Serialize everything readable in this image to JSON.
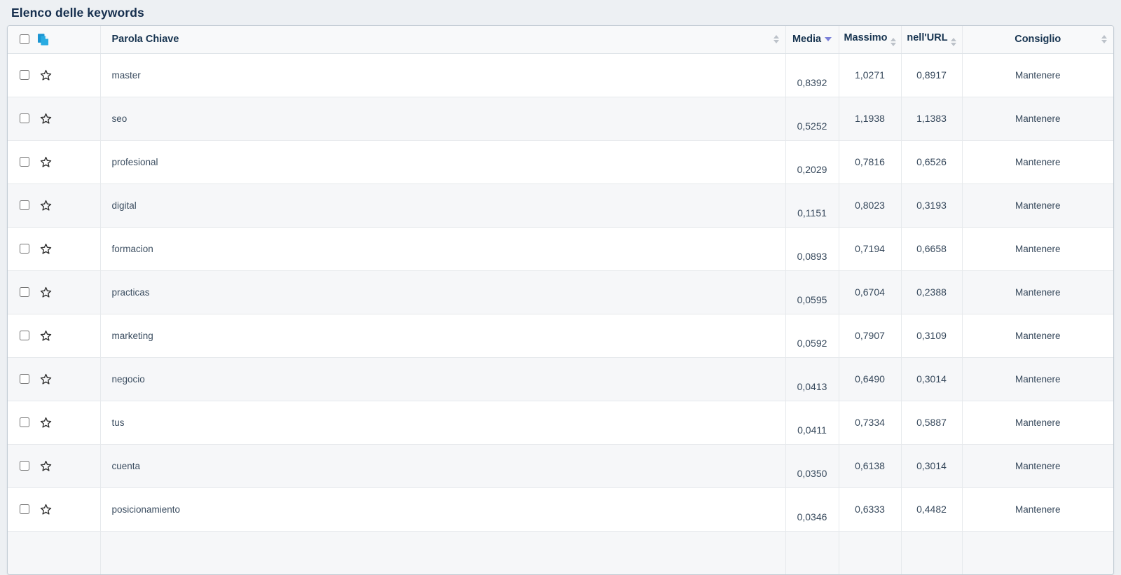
{
  "page": {
    "title": "Elenco delle keywords"
  },
  "colors": {
    "accent_blue": "#29abe2",
    "sort_active": "#7b80d8",
    "sort_inactive": "#bcc2c9",
    "header_text": "#173450",
    "page_background": "#edf0f3"
  },
  "icons": {
    "copy": "copy-pages-icon",
    "star": "star-outline-icon",
    "sort_unsorted": "up-down-arrows",
    "sort_media": "down-arrow-desc"
  },
  "table": {
    "select_all_checked": false,
    "columns": {
      "keyword": {
        "label": "Parola Chiave",
        "sortable": true,
        "sorted": null
      },
      "media": {
        "label": "Media",
        "sortable": true,
        "sorted": "desc"
      },
      "massimo": {
        "label": "Massimo",
        "sortable": true,
        "sorted": null
      },
      "nell_url": {
        "label": "nell'URL",
        "sortable": true,
        "sorted": null
      },
      "consiglio": {
        "label": "Consiglio",
        "sortable": true,
        "sorted": null
      }
    },
    "rows": [
      {
        "keyword": "master",
        "media": "0,8392",
        "massimo": "1,0271",
        "nell_url": "0,8917",
        "consiglio": "Mantenere",
        "checked": false,
        "starred": false
      },
      {
        "keyword": "seo",
        "media": "0,5252",
        "massimo": "1,1938",
        "nell_url": "1,1383",
        "consiglio": "Mantenere",
        "checked": false,
        "starred": false
      },
      {
        "keyword": "profesional",
        "media": "0,2029",
        "massimo": "0,7816",
        "nell_url": "0,6526",
        "consiglio": "Mantenere",
        "checked": false,
        "starred": false
      },
      {
        "keyword": "digital",
        "media": "0,1151",
        "massimo": "0,8023",
        "nell_url": "0,3193",
        "consiglio": "Mantenere",
        "checked": false,
        "starred": false
      },
      {
        "keyword": "formacion",
        "media": "0,0893",
        "massimo": "0,7194",
        "nell_url": "0,6658",
        "consiglio": "Mantenere",
        "checked": false,
        "starred": false
      },
      {
        "keyword": "practicas",
        "media": "0,0595",
        "massimo": "0,6704",
        "nell_url": "0,2388",
        "consiglio": "Mantenere",
        "checked": false,
        "starred": false
      },
      {
        "keyword": "marketing",
        "media": "0,0592",
        "massimo": "0,7907",
        "nell_url": "0,3109",
        "consiglio": "Mantenere",
        "checked": false,
        "starred": false
      },
      {
        "keyword": "negocio",
        "media": "0,0413",
        "massimo": "0,6490",
        "nell_url": "0,3014",
        "consiglio": "Mantenere",
        "checked": false,
        "starred": false
      },
      {
        "keyword": "tus",
        "media": "0,0411",
        "massimo": "0,7334",
        "nell_url": "0,5887",
        "consiglio": "Mantenere",
        "checked": false,
        "starred": false
      },
      {
        "keyword": "cuenta",
        "media": "0,0350",
        "massimo": "0,6138",
        "nell_url": "0,3014",
        "consiglio": "Mantenere",
        "checked": false,
        "starred": false
      },
      {
        "keyword": "posicionamiento",
        "media": "0,0346",
        "massimo": "0,6333",
        "nell_url": "0,4482",
        "consiglio": "Mantenere",
        "checked": false,
        "starred": false
      }
    ]
  }
}
